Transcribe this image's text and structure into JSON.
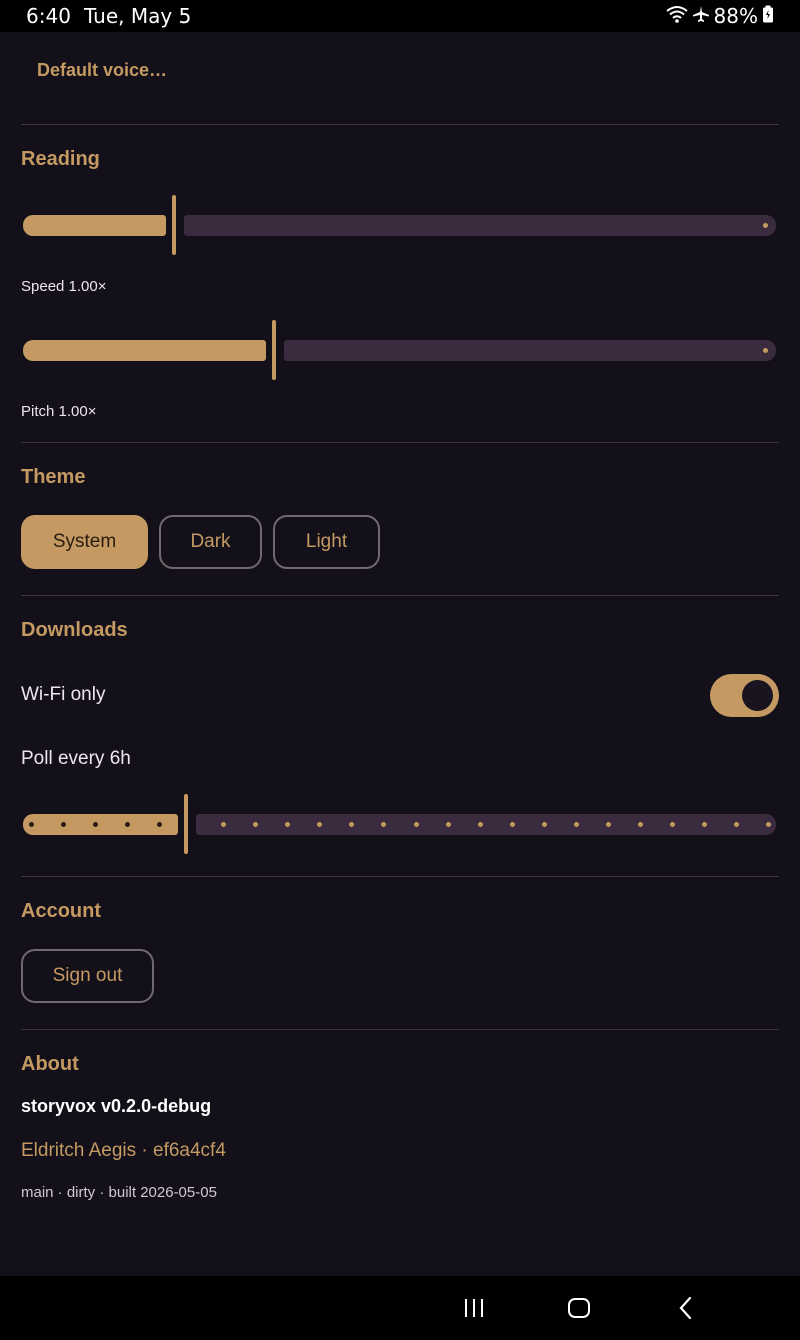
{
  "status": {
    "time": "6:40",
    "date": "Tue, May 5",
    "battery": "88%"
  },
  "voice": {
    "default_label": "Default voice…"
  },
  "reading": {
    "title": "Reading",
    "speed": {
      "label": "Speed 1.00×",
      "value": 0.2
    },
    "pitch": {
      "label": "Pitch 1.00×",
      "value": 0.333
    }
  },
  "theme": {
    "title": "Theme",
    "options": [
      "System",
      "Dark",
      "Light"
    ],
    "selected": "System"
  },
  "downloads": {
    "title": "Downloads",
    "wifi_only_label": "Wi-Fi only",
    "wifi_only": true,
    "poll_label": "Poll every 6h",
    "poll_value": 0.217
  },
  "account": {
    "title": "Account",
    "sign_out_label": "Sign out"
  },
  "about": {
    "title": "About",
    "app_name": "storyvox v0.2.0-debug",
    "build": "Eldritch Aegis · ef6a4cf4",
    "meta": "main · dirty · built 2026-05-05"
  },
  "colors": {
    "accent": "#c49a62",
    "background": "#13101a",
    "track_inactive": "#3b2b3e"
  },
  "icons": [
    "wifi-icon",
    "airplane-mode-icon",
    "battery-icon",
    "recents-icon",
    "home-icon",
    "back-icon"
  ]
}
